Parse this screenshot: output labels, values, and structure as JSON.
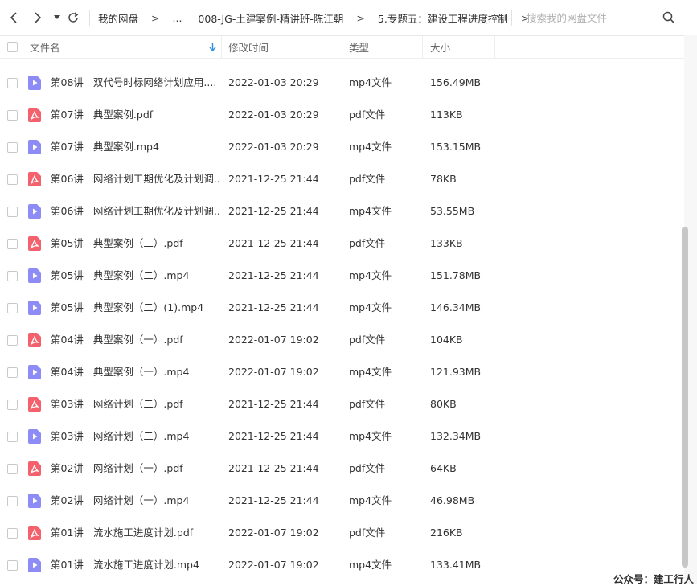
{
  "breadcrumb": [
    "我的网盘",
    "...",
    "008-JG-土建案例-精讲班-陈江朝",
    "5.专题五：建设工程进度控制"
  ],
  "breadcrumb_separator": ">",
  "search": {
    "placeholder": "搜索我的网盘文件"
  },
  "columns": {
    "name": "文件名",
    "modified": "修改时间",
    "type": "类型",
    "size": "大小"
  },
  "sort": {
    "column": "name",
    "direction": "descending"
  },
  "files": [
    {
      "lecture": "第08讲",
      "title": "双代号时标网络计划应用....",
      "date": "2022-01-03 20:29",
      "type": "mp4文件",
      "size": "156.49MB",
      "icon": "video-file-icon"
    },
    {
      "lecture": "第07讲",
      "title": "典型案例.pdf",
      "date": "2022-01-03 20:29",
      "type": "pdf文件",
      "size": "113KB",
      "icon": "pdf-file-icon"
    },
    {
      "lecture": "第07讲",
      "title": "典型案例.mp4",
      "date": "2022-01-03 20:29",
      "type": "mp4文件",
      "size": "153.15MB",
      "icon": "video-file-icon"
    },
    {
      "lecture": "第06讲",
      "title": "网络计划工期优化及计划调...",
      "date": "2021-12-25 21:44",
      "type": "pdf文件",
      "size": "78KB",
      "icon": "pdf-file-icon"
    },
    {
      "lecture": "第06讲",
      "title": "网络计划工期优化及计划调...",
      "date": "2021-12-25 21:44",
      "type": "mp4文件",
      "size": "53.55MB",
      "icon": "video-file-icon"
    },
    {
      "lecture": "第05讲",
      "title": "典型案例（二）.pdf",
      "date": "2021-12-25 21:44",
      "type": "pdf文件",
      "size": "133KB",
      "icon": "pdf-file-icon"
    },
    {
      "lecture": "第05讲",
      "title": "典型案例（二）.mp4",
      "date": "2021-12-25 21:44",
      "type": "mp4文件",
      "size": "151.78MB",
      "icon": "video-file-icon"
    },
    {
      "lecture": "第05讲",
      "title": "典型案例（二）(1).mp4",
      "date": "2021-12-25 21:44",
      "type": "mp4文件",
      "size": "146.34MB",
      "icon": "video-file-icon"
    },
    {
      "lecture": "第04讲",
      "title": "典型案例（一）.pdf",
      "date": "2022-01-07 19:02",
      "type": "pdf文件",
      "size": "104KB",
      "icon": "pdf-file-icon"
    },
    {
      "lecture": "第04讲",
      "title": "典型案例（一）.mp4",
      "date": "2022-01-07 19:02",
      "type": "mp4文件",
      "size": "121.93MB",
      "icon": "video-file-icon"
    },
    {
      "lecture": "第03讲",
      "title": "网络计划（二）.pdf",
      "date": "2021-12-25 21:44",
      "type": "pdf文件",
      "size": "80KB",
      "icon": "pdf-file-icon"
    },
    {
      "lecture": "第03讲",
      "title": "网络计划（二）.mp4",
      "date": "2021-12-25 21:44",
      "type": "mp4文件",
      "size": "132.34MB",
      "icon": "video-file-icon"
    },
    {
      "lecture": "第02讲",
      "title": "网络计划（一）.pdf",
      "date": "2021-12-25 21:44",
      "type": "pdf文件",
      "size": "64KB",
      "icon": "pdf-file-icon"
    },
    {
      "lecture": "第02讲",
      "title": "网络计划（一）.mp4",
      "date": "2021-12-25 21:44",
      "type": "mp4文件",
      "size": "46.98MB",
      "icon": "video-file-icon"
    },
    {
      "lecture": "第01讲",
      "title": "流水施工进度计划.pdf",
      "date": "2022-01-07 19:02",
      "type": "pdf文件",
      "size": "216KB",
      "icon": "pdf-file-icon"
    },
    {
      "lecture": "第01讲",
      "title": "流水施工进度计划.mp4",
      "date": "2022-01-07 19:02",
      "type": "mp4文件",
      "size": "133.41MB",
      "icon": "video-file-icon"
    }
  ],
  "watermark": "公众号：建工行人",
  "colors": {
    "video_icon": "#8d8cf7",
    "pdf_icon": "#f4606c",
    "sort_arrow": "#2f8de4"
  }
}
